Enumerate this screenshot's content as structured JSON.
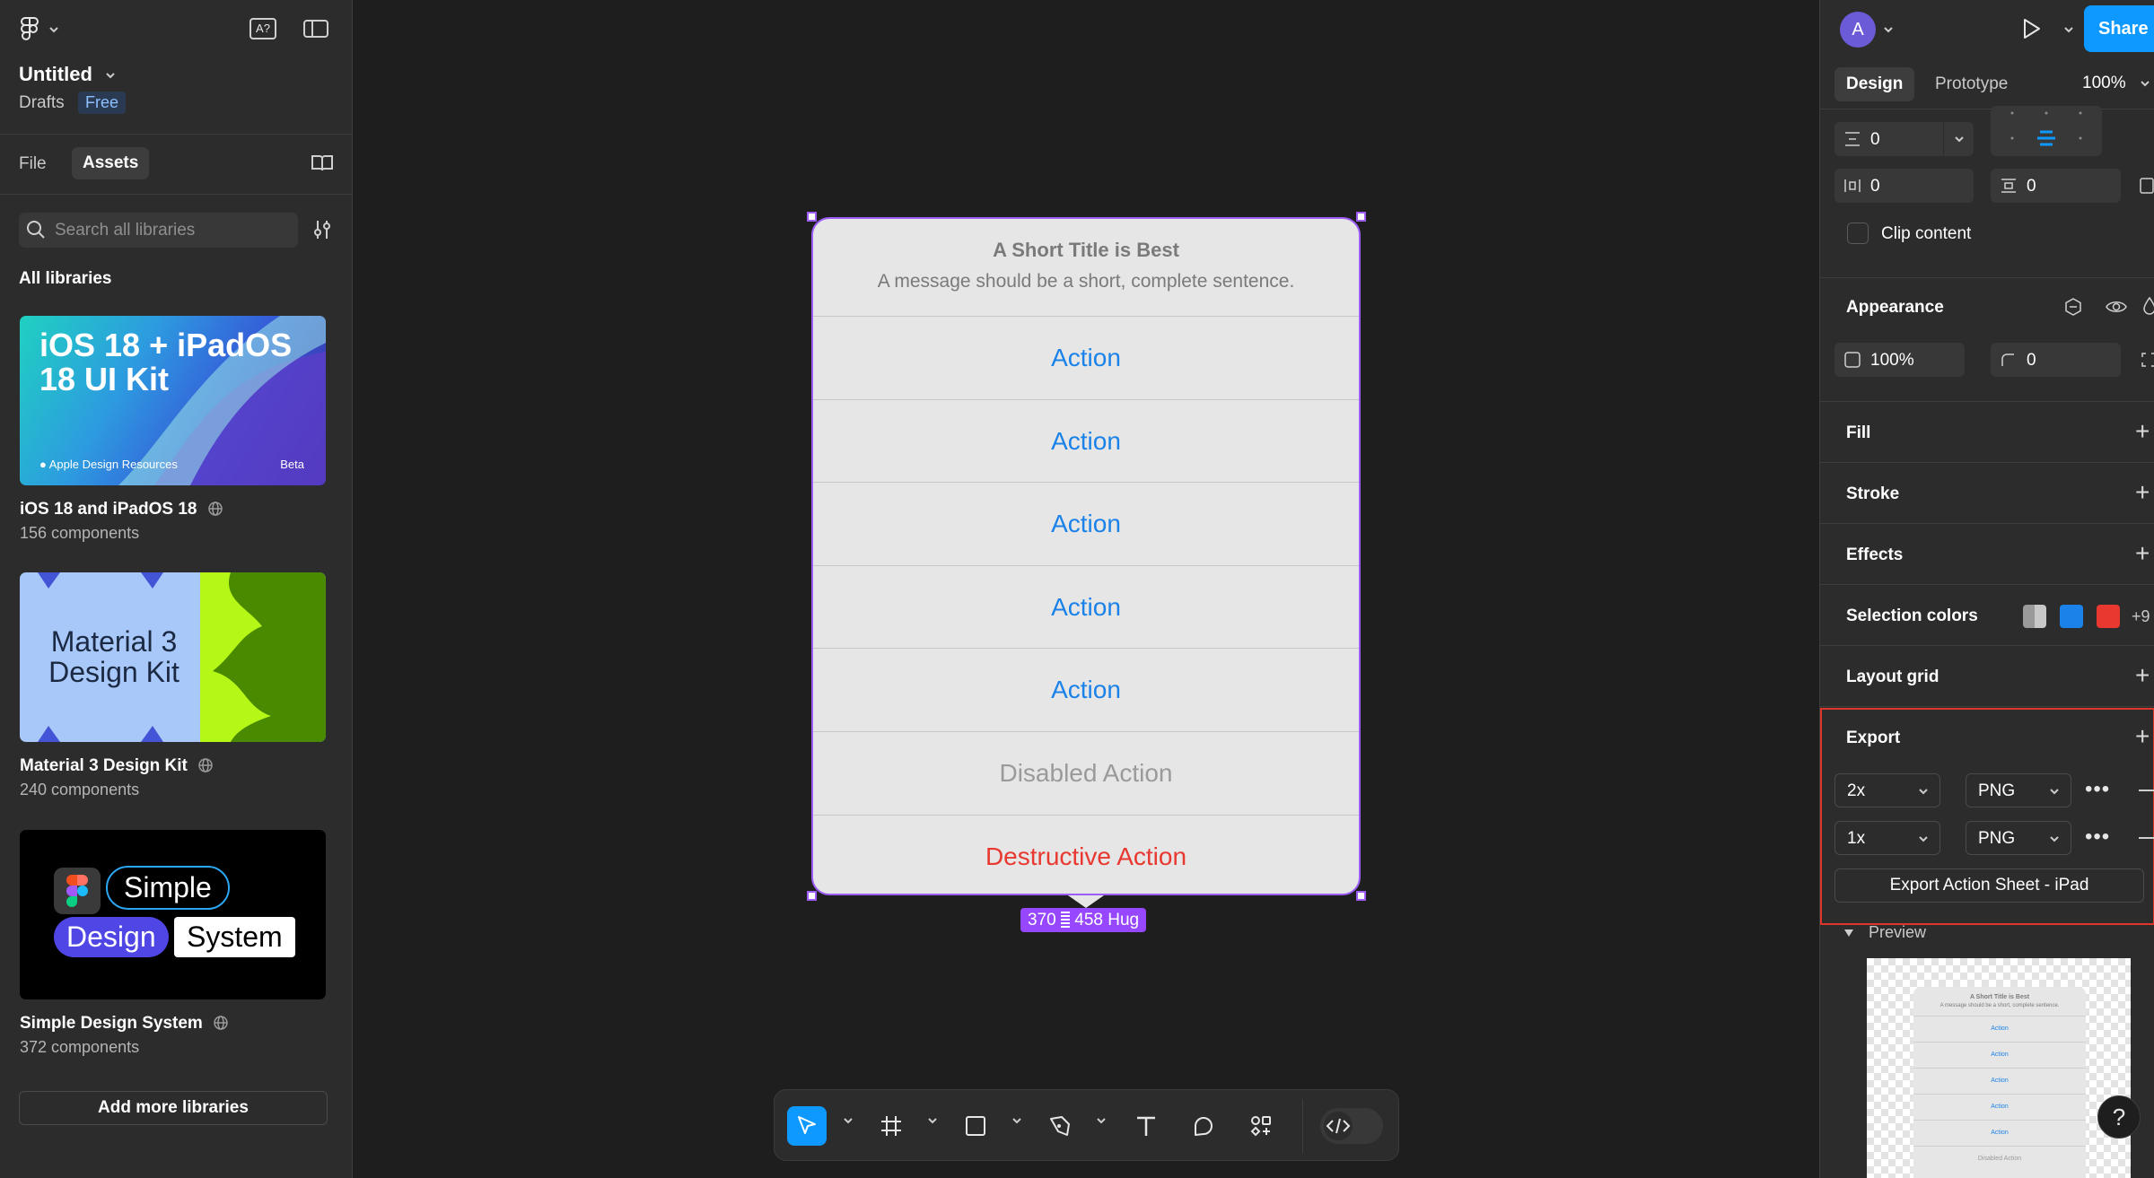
{
  "left_panel": {
    "file_name": "Untitled",
    "location": "Drafts",
    "plan_badge": "Free",
    "tabs": [
      "File",
      "Assets"
    ],
    "search_placeholder": "Search all libraries",
    "section_heading": "All libraries",
    "libraries": [
      {
        "thumb_title": "iOS 18 + iPadOS 18 UI Kit",
        "thumb_footer": "Apple Design Resources",
        "thumb_tag": "Beta",
        "name": "iOS 18 and iPadOS 18",
        "count": "156 components"
      },
      {
        "thumb_title": "Material 3 Design Kit",
        "name": "Material 3 Design Kit",
        "count": "240 components"
      },
      {
        "thumb_words": [
          "Simple",
          "Design",
          "System"
        ],
        "name": "Simple Design System",
        "count": "372 components"
      }
    ],
    "add_button": "Add more libraries"
  },
  "canvas": {
    "title": "A Short Title is Best",
    "message": "A message should be a short, complete sentence.",
    "actions": [
      {
        "label": "Action",
        "kind": "default"
      },
      {
        "label": "Action",
        "kind": "default"
      },
      {
        "label": "Action",
        "kind": "default"
      },
      {
        "label": "Action",
        "kind": "default"
      },
      {
        "label": "Action",
        "kind": "default"
      },
      {
        "label": "Disabled Action",
        "kind": "disabled"
      },
      {
        "label": "Destructive Action",
        "kind": "destructive"
      }
    ],
    "size_badge": {
      "width": "370",
      "height": "458 Hug"
    },
    "colors": {
      "action": "#1a82e8",
      "disabled": "#9a9a9a",
      "destructive": "#e8382f",
      "selection": "#9c5cf5"
    }
  },
  "toolbar": {
    "tools": [
      "move-tool",
      "frame-tool",
      "rectangle-tool",
      "pen-tool",
      "text-tool",
      "comment-tool",
      "components-tool",
      "dev-mode-toggle"
    ]
  },
  "right_panel": {
    "avatar_letter": "A",
    "share_label": "Share",
    "tabs": [
      "Design",
      "Prototype"
    ],
    "zoom": "100%",
    "auto_layout": {
      "gap": "0",
      "padding_h": "0",
      "padding_v": "0"
    },
    "clip_content_label": "Clip content",
    "appearance": {
      "title": "Appearance",
      "opacity": "100%",
      "radius": "0"
    },
    "sections": [
      "Fill",
      "Stroke",
      "Effects"
    ],
    "selection_colors": {
      "title": "Selection colors",
      "swatches": [
        "#9a9a9a",
        "#1a82e8",
        "#e8382f"
      ],
      "more": "+9"
    },
    "layout_grid": "Layout grid",
    "export": {
      "title": "Export",
      "rows": [
        {
          "scale": "2x",
          "format": "PNG"
        },
        {
          "scale": "1x",
          "format": "PNG"
        }
      ],
      "button": "Export Action Sheet - iPad"
    },
    "preview": {
      "label": "Preview",
      "title": "A Short Title is Best",
      "message": "A message should be a short, complete sentence.",
      "actions": [
        "Action",
        "Action",
        "Action",
        "Action",
        "Action",
        "Disabled Action"
      ]
    },
    "help": "?"
  }
}
